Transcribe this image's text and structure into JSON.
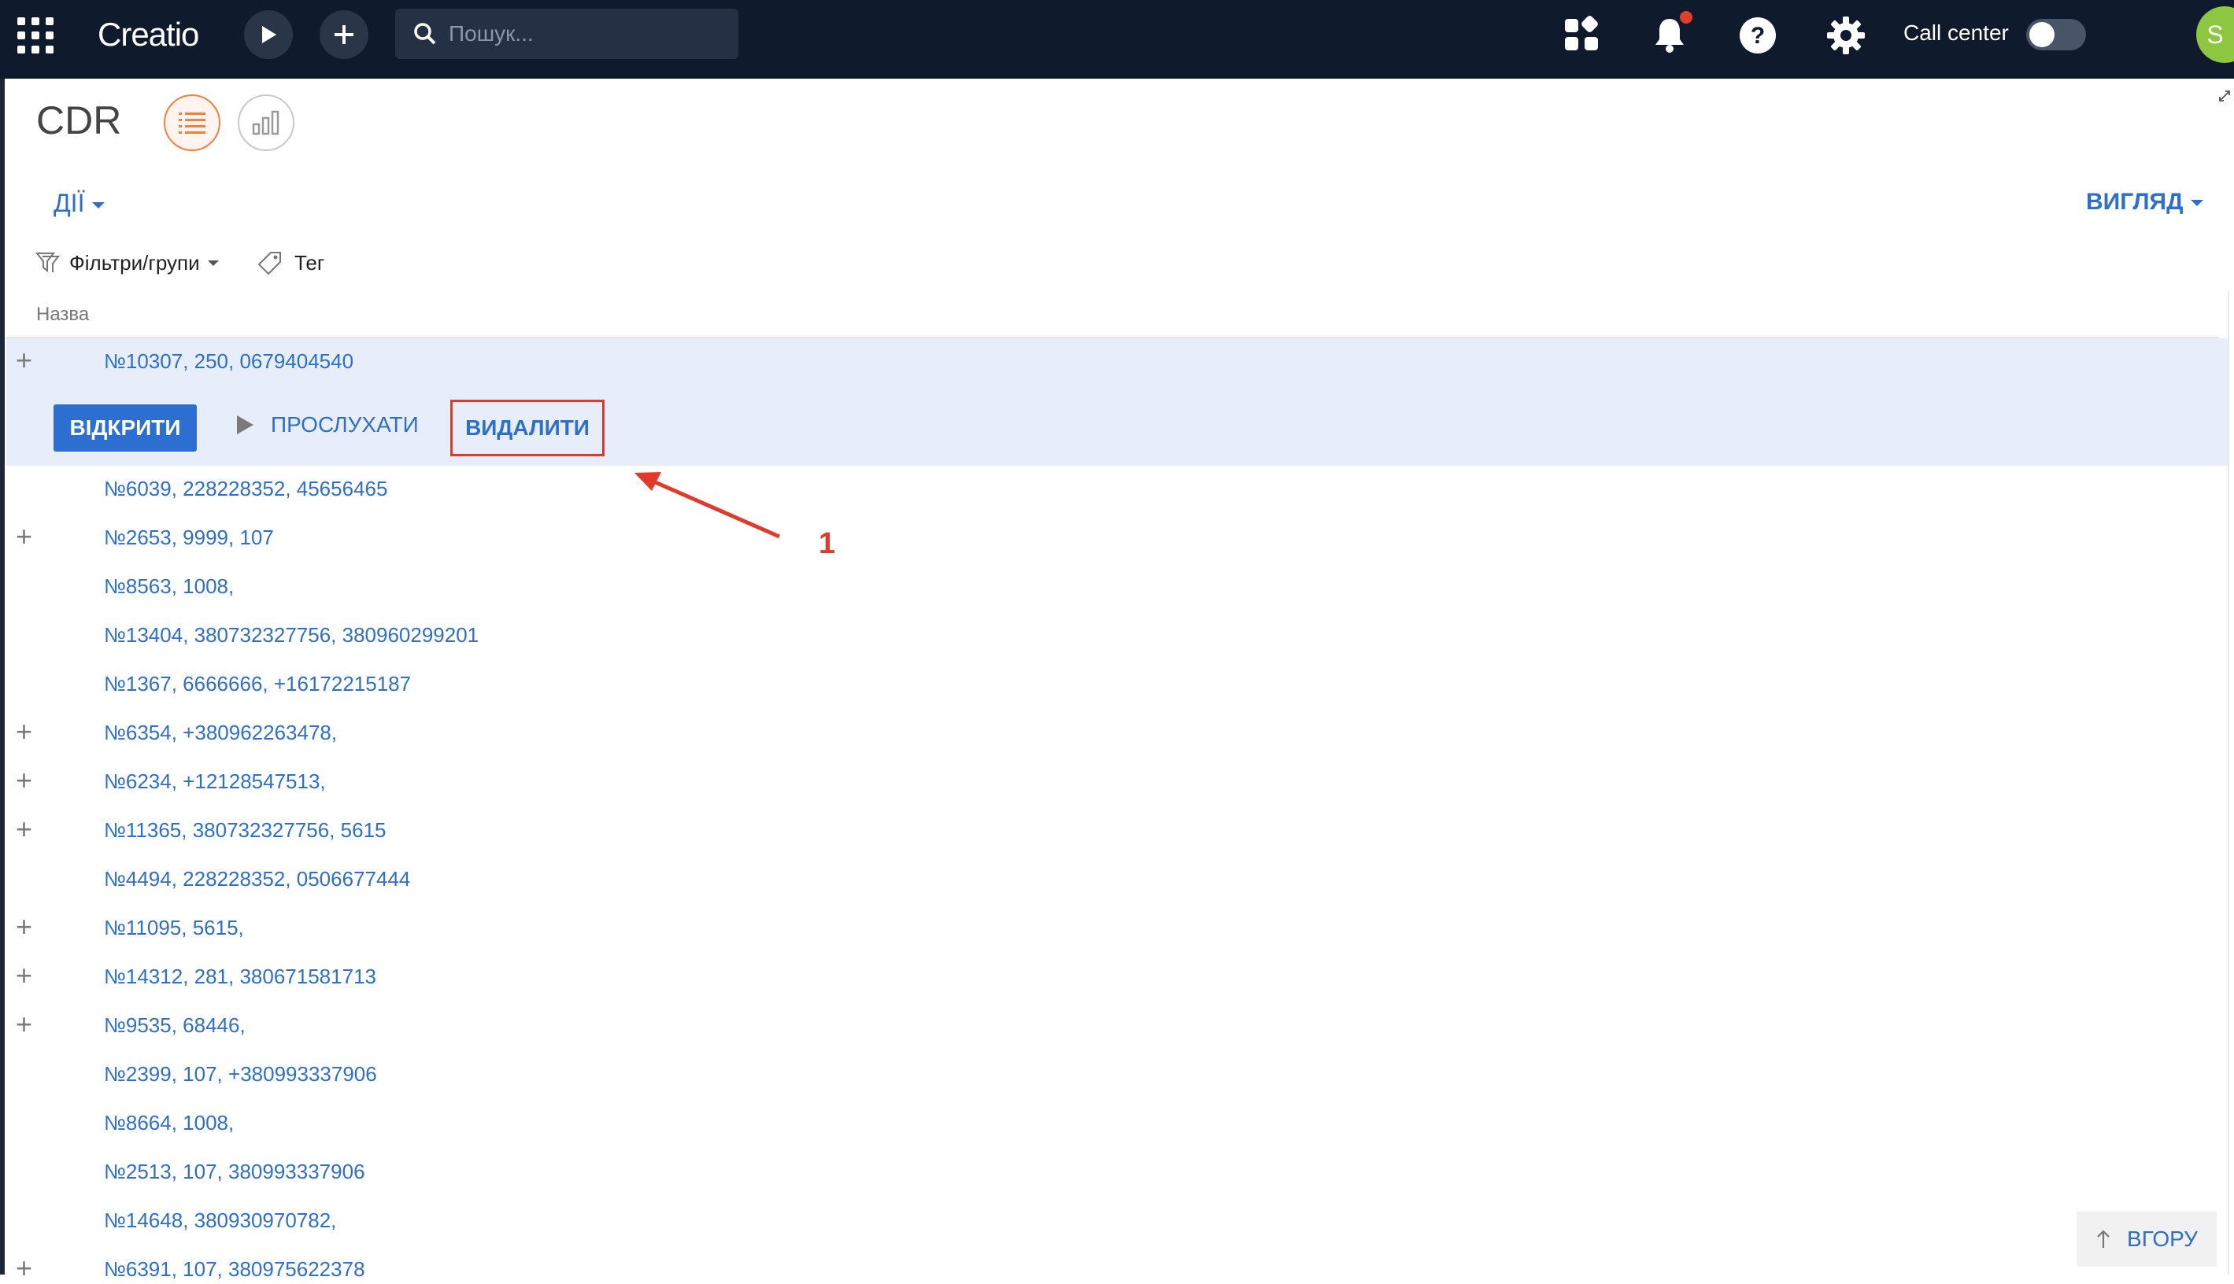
{
  "header": {
    "logo_text": "Creatio",
    "search_placeholder": "Пошук...",
    "call_center_label": "Call center",
    "avatar_initial": "S"
  },
  "page": {
    "title": "CDR",
    "actions_label": "ДІЇ",
    "view_label": "ВИГЛЯД",
    "filters_label": "Фільтри/групи",
    "tag_label": "Тег",
    "column_name": "Назва"
  },
  "selected": {
    "record": "№10307, 250, 0679404540",
    "open_label": "ВІДКРИТИ",
    "listen_label": "ПРОСЛУХАТИ",
    "delete_label": "ВИДАЛИТИ"
  },
  "records": [
    {
      "text": "№6039, 228228352, 45656465",
      "expand": false
    },
    {
      "text": "№2653, 9999, 107",
      "expand": true
    },
    {
      "text": "№8563, 1008,",
      "expand": false
    },
    {
      "text": "№13404, 380732327756, 380960299201",
      "expand": false
    },
    {
      "text": "№1367, 6666666, +16172215187",
      "expand": false
    },
    {
      "text": "№6354, +380962263478,",
      "expand": true
    },
    {
      "text": "№6234, +12128547513,",
      "expand": true
    },
    {
      "text": "№11365, 380732327756, 5615",
      "expand": true
    },
    {
      "text": "№4494, 228228352, 0506677444",
      "expand": false
    },
    {
      "text": "№11095, 5615,",
      "expand": true
    },
    {
      "text": "№14312, 281, 380671581713",
      "expand": true
    },
    {
      "text": "№9535, 68446,",
      "expand": true
    },
    {
      "text": "№2399, 107, +380993337906",
      "expand": false
    },
    {
      "text": "№8664, 1008,",
      "expand": false
    },
    {
      "text": "№2513, 107, 380993337906",
      "expand": false
    },
    {
      "text": "№14648, 380930970782,",
      "expand": false
    },
    {
      "text": "№6391, 107, 380975622378",
      "expand": true
    }
  ],
  "annotation": {
    "label": "1",
    "color": "#e13a2b"
  },
  "back_to_top_label": "ВГОРУ",
  "colors": {
    "topbar": "#0f1b2c",
    "link": "#2c6fd1",
    "accent": "#f5803e",
    "selected_row": "#e8eef9"
  }
}
